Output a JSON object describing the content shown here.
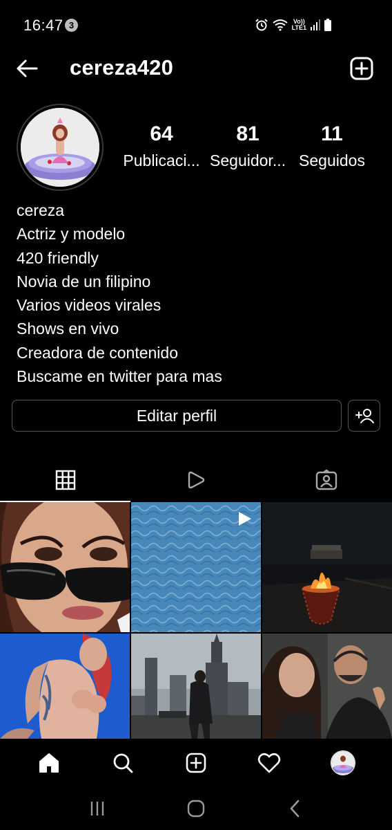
{
  "status_bar": {
    "time": "16:47",
    "notification_count": "3",
    "network_label_top": "Vo))",
    "network_label_bottom": "LTE1"
  },
  "header": {
    "username": "cereza420"
  },
  "profile": {
    "stats": [
      {
        "value": "64",
        "label": "Publicaci..."
      },
      {
        "value": "81",
        "label": "Seguidor..."
      },
      {
        "value": "11",
        "label": "Seguidos"
      }
    ],
    "bio": [
      "cereza",
      "Actriz y modelo",
      "420 friendly",
      "Novia de un filipino",
      "Varios videos virales",
      "Shows en vivo",
      "Creadora de contenido",
      "Buscame en twitter para mas"
    ],
    "edit_button": "Editar perfil"
  },
  "tabs": [
    {
      "icon": "grid-icon",
      "active": true
    },
    {
      "icon": "reels-icon",
      "active": false
    },
    {
      "icon": "tagged-icon",
      "active": false
    }
  ],
  "grid_posts": [
    {
      "kind": "photo",
      "description_icon": "selfie-sunglasses-image"
    },
    {
      "kind": "reel",
      "description_icon": "pool-water-image"
    },
    {
      "kind": "photo",
      "description_icon": "fire-pit-night-image"
    },
    {
      "kind": "photo",
      "description_icon": "tattoo-blue-background-image"
    },
    {
      "kind": "photo",
      "description_icon": "city-tower-image"
    },
    {
      "kind": "photo",
      "description_icon": "couple-selfie-image"
    }
  ],
  "colors": {
    "background": "#000000",
    "text": "#ffffff",
    "border": "#555555"
  }
}
